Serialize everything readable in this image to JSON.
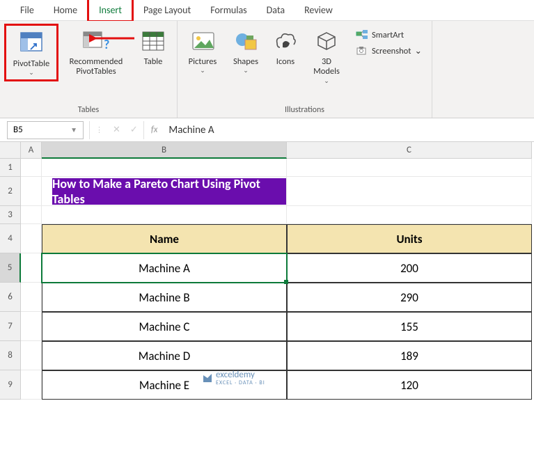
{
  "tabs": {
    "file": "File",
    "home": "Home",
    "insert": "Insert",
    "page_layout": "Page Layout",
    "formulas": "Formulas",
    "data": "Data",
    "review": "Review"
  },
  "ribbon": {
    "pivot_table": "PivotTable",
    "recommended": "Recommended\nPivotTables",
    "table": "Table",
    "pictures": "Pictures",
    "shapes": "Shapes",
    "icons": "Icons",
    "models3d": "3D\nModels",
    "smartart": "SmartArt",
    "screenshot": "Screenshot",
    "group_tables": "Tables",
    "group_illustrations": "Illustrations"
  },
  "formula_bar": {
    "namebox": "B5",
    "value": "Machine A"
  },
  "columns": {
    "A": "A",
    "B": "B",
    "C": "C"
  },
  "rows": [
    "1",
    "2",
    "3",
    "4",
    "5",
    "6",
    "7",
    "8",
    "9"
  ],
  "content": {
    "title": "How to Make a Pareto Chart Using Pivot Tables",
    "header_name": "Name",
    "header_units": "Units",
    "data": [
      {
        "name": "Machine A",
        "units": "200"
      },
      {
        "name": "Machine B",
        "units": "290"
      },
      {
        "name": "Machine C",
        "units": "155"
      },
      {
        "name": "Machine D",
        "units": "189"
      },
      {
        "name": "Machine E",
        "units": "120"
      }
    ]
  },
  "watermark": {
    "brand": "exceldemy",
    "tagline": "EXCEL · DATA · BI"
  }
}
